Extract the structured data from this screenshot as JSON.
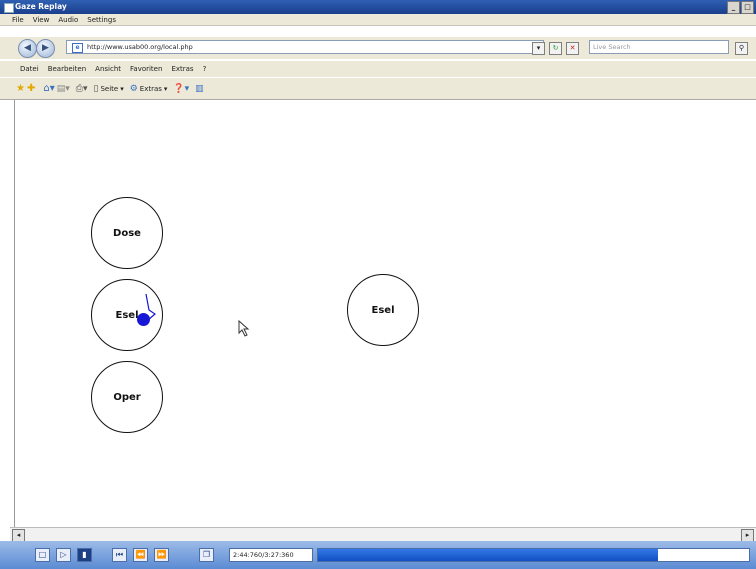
{
  "window": {
    "title": "Gaze Replay",
    "buttons": [
      "_",
      "□"
    ],
    "menu": [
      "File",
      "View",
      "Audio",
      "Settings"
    ]
  },
  "browser": {
    "address": "http://www.usab00.org/local.php",
    "search_placeholder": "Live Search",
    "menu": [
      "Datei",
      "Bearbeiten",
      "Ansicht",
      "Favoriten",
      "Extras",
      "?"
    ],
    "toolbar": {
      "seite": "Seite",
      "extras": "Extras"
    }
  },
  "stimuli": {
    "left": [
      "Dose",
      "Esel",
      "Oper"
    ],
    "target": "Esel"
  },
  "player": {
    "time": "2:44:760/3:27:360",
    "progress": 0.79
  },
  "colors": {
    "gaze": "#1717d6",
    "progress": "#1f5ad4"
  }
}
